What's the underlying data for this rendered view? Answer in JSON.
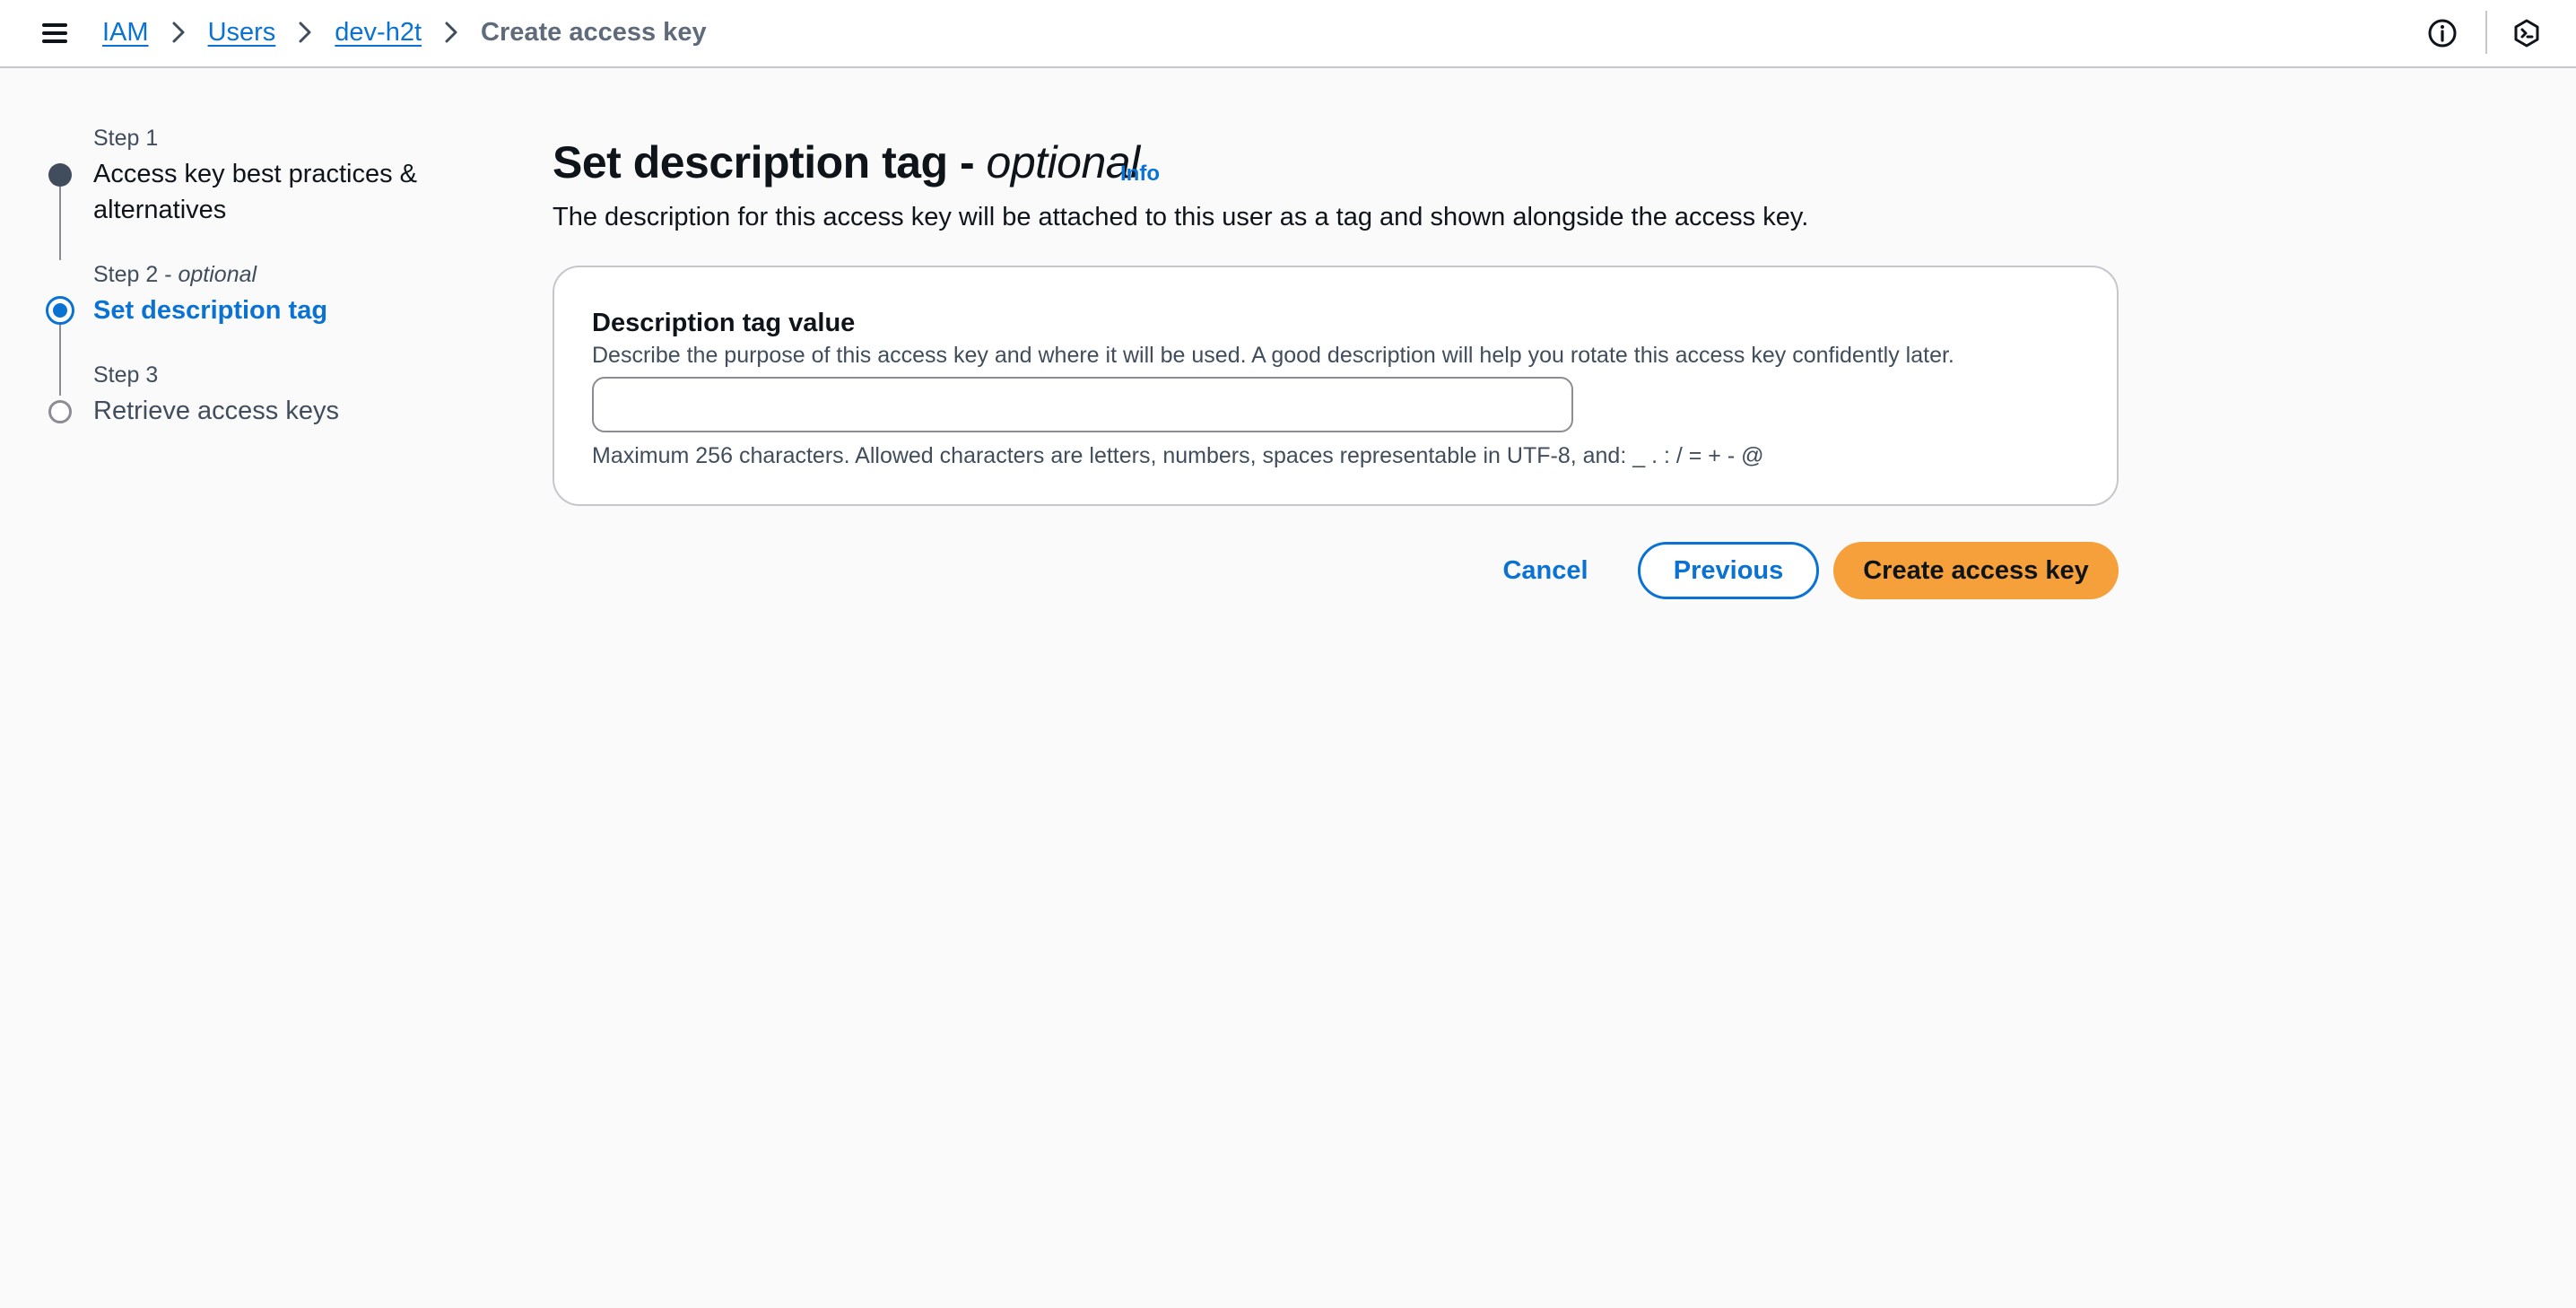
{
  "breadcrumbs": {
    "items": [
      {
        "label": "IAM"
      },
      {
        "label": "Users"
      },
      {
        "label": "dev-h2t"
      }
    ],
    "current": "Create access key"
  },
  "steps": [
    {
      "label": "Step 1",
      "label_suffix": "",
      "title": "Access key best practices & alternatives",
      "state": "completed"
    },
    {
      "label": "Step 2 - ",
      "label_suffix": "optional",
      "title": "Set description tag",
      "state": "active"
    },
    {
      "label": "Step 3",
      "label_suffix": "",
      "title": "Retrieve access keys",
      "state": "disabled"
    }
  ],
  "main": {
    "title": "Set description tag - ",
    "title_suffix": "optional",
    "info_link": "Info",
    "description": "The description for this access key will be attached to this user as a tag and shown alongside the access key.",
    "field": {
      "label": "Description tag value",
      "description": "Describe the purpose of this access key and where it will be used. A good description will help you rotate this access key confidently later.",
      "value": "",
      "constraint": "Maximum 256 characters. Allowed characters are letters, numbers, spaces representable in UTF-8, and: _ . : / = + - @"
    }
  },
  "actions": {
    "cancel": "Cancel",
    "previous": "Previous",
    "create": "Create access key"
  },
  "colors": {
    "link": "#0972d3",
    "primary_button": "#f5a03a",
    "completed_step": "#414d5c",
    "disabled_step": "#8c8c94"
  },
  "icons": {
    "menu": "hamburger-menu-icon",
    "breadcrumb_separator": "chevron-right-icon",
    "info": "info-circle-icon",
    "cloudshell": "hexagon-shell-icon"
  }
}
